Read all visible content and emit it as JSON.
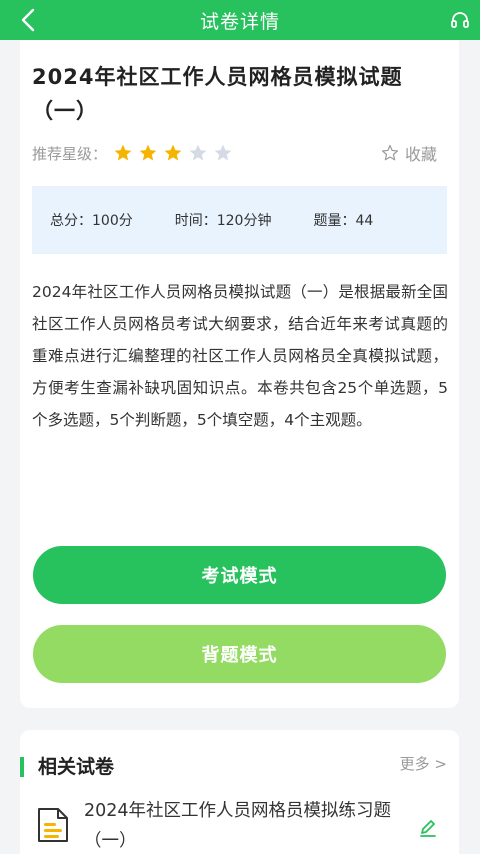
{
  "header": {
    "title": "试卷详情"
  },
  "paper": {
    "title": "2024年社区工作人员网格员模拟试题（一）",
    "rating_label": "推荐星级：",
    "rating": 3,
    "rating_max": 5,
    "favorite_label": "收藏",
    "total_score": "总分：100分",
    "time": "时间：120分钟",
    "question_count": "题量：44",
    "description": "2024年社区工作人员网格员模拟试题（一）是根据最新全国社区工作人员网格员考试大纲要求，结合近年来考试真题的重难点进行汇编整理的社区工作人员网格员全真模拟试题，方便考生查漏补缺巩固知识点。本卷共包含25个单选题，5个多选题，5个判断题，5个填空题，4个主观题。"
  },
  "buttons": {
    "exam_mode": "考试模式",
    "memorize_mode": "背题模式"
  },
  "related": {
    "title": "相关试卷",
    "more": "更多 >",
    "items": [
      {
        "title": "2024年社区工作人员网格员模拟练习题（一）"
      }
    ]
  },
  "colors": {
    "primary": "#27c15e",
    "secondary_button": "#93db63",
    "star_filled": "#f5b400",
    "star_empty": "#d5dae4",
    "info_bg": "#e8f3fd"
  }
}
